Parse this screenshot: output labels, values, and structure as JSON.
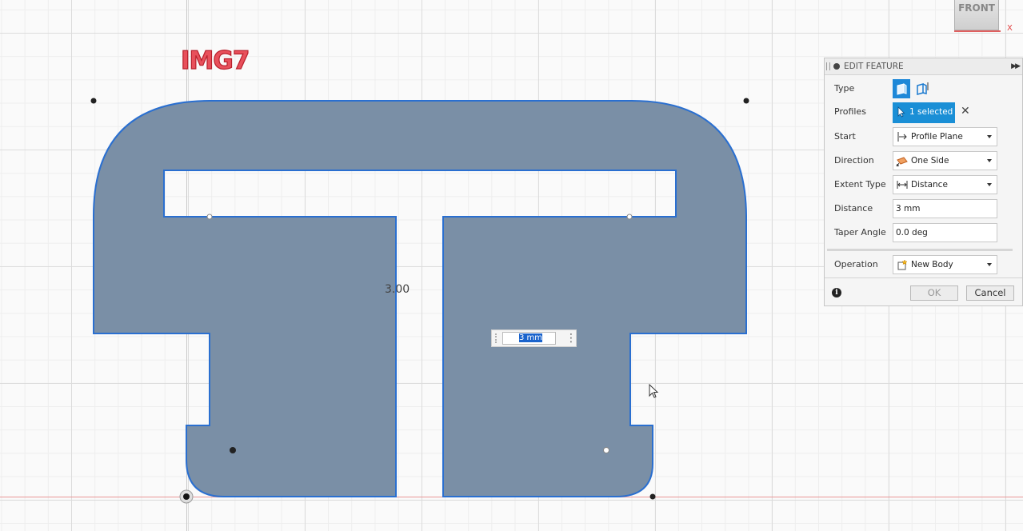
{
  "viewport": {
    "watermark": "IMG7",
    "dimension_label": "3.00",
    "inline_distance_value": "3 mm",
    "viewcube_face": "FRONT",
    "viewcube_axis": "X",
    "profile_fill": "#7a8fa6",
    "profile_stroke": "#2a6fd0"
  },
  "panel": {
    "title": "EDIT FEATURE",
    "fields": {
      "type_label": "Type",
      "profiles_label": "Profiles",
      "profiles_value": "1 selected",
      "start_label": "Start",
      "start_value": "Profile Plane",
      "direction_label": "Direction",
      "direction_value": "One Side",
      "extent_label": "Extent Type",
      "extent_value": "Distance",
      "distance_label": "Distance",
      "distance_value": "3 mm",
      "taper_label": "Taper Angle",
      "taper_value": "0.0 deg",
      "operation_label": "Operation",
      "operation_value": "New Body"
    },
    "buttons": {
      "ok": "OK",
      "cancel": "Cancel"
    },
    "icons": {
      "type_one": "extrude-solid-icon",
      "type_two": "extrude-thin-icon",
      "profiles": "select-arrow-icon",
      "clear": "close-icon",
      "start": "profile-plane-icon",
      "direction": "one-side-icon",
      "extent": "distance-icon",
      "operation": "new-body-icon",
      "info": "info-icon"
    },
    "accent_color": "#1a8fd6"
  }
}
